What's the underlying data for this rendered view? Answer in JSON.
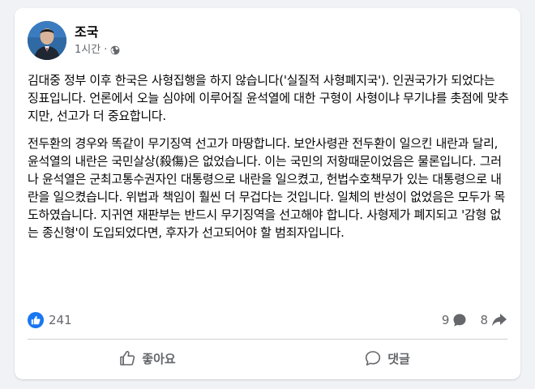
{
  "post": {
    "author": "조국",
    "time": "1시간",
    "separator": "·",
    "privacy_icon": "globe-icon",
    "paragraphs": [
      "김대중 정부 이후 한국은 사형집행을 하지 않습니다('실질적 사형폐지국'). 인권국가가 되었다는 징표입니다. 언론에서 오늘 심야에 이루어질 윤석열에 대한 구형이 사형이냐 무기냐를 촛점에 맞추지만, 선고가 더 중요합니다.",
      "전두환의 경우와 똑같이 무기징역 선고가 마땅합니다. 보안사령관 전두환이 일으킨 내란과 달리, 윤석열의 내란은 국민살상(殺傷)은 없었습니다. 이는 국민의 저항때문이었음은 물론입니다. 그러나 윤석열은 군최고통수권자인 대통령으로 내란을 일으켰고, 헌법수호책무가 있는 대통령으로 내란을 일으켰습니다. 위법과 책임이 훨씬 더 무겁다는 것입니다. 일체의 반성이 없었음은 모두가 목도하였습니다. 지귀연 재판부는 반드시 무기징역을 선고해야 합니다. 사형제가 폐지되고 '감형 없는 종신형'이 도입되었다면, 후자가 선고되어야 할 범죄자입니다."
    ]
  },
  "stats": {
    "likes": "241",
    "comments": "9",
    "shares": "8"
  },
  "actions": {
    "like_label": "좋아요",
    "comment_label": "댓글"
  },
  "colors": {
    "accent": "#1877f2",
    "secondary_text": "#65676b",
    "background": "#f0f2f5"
  }
}
